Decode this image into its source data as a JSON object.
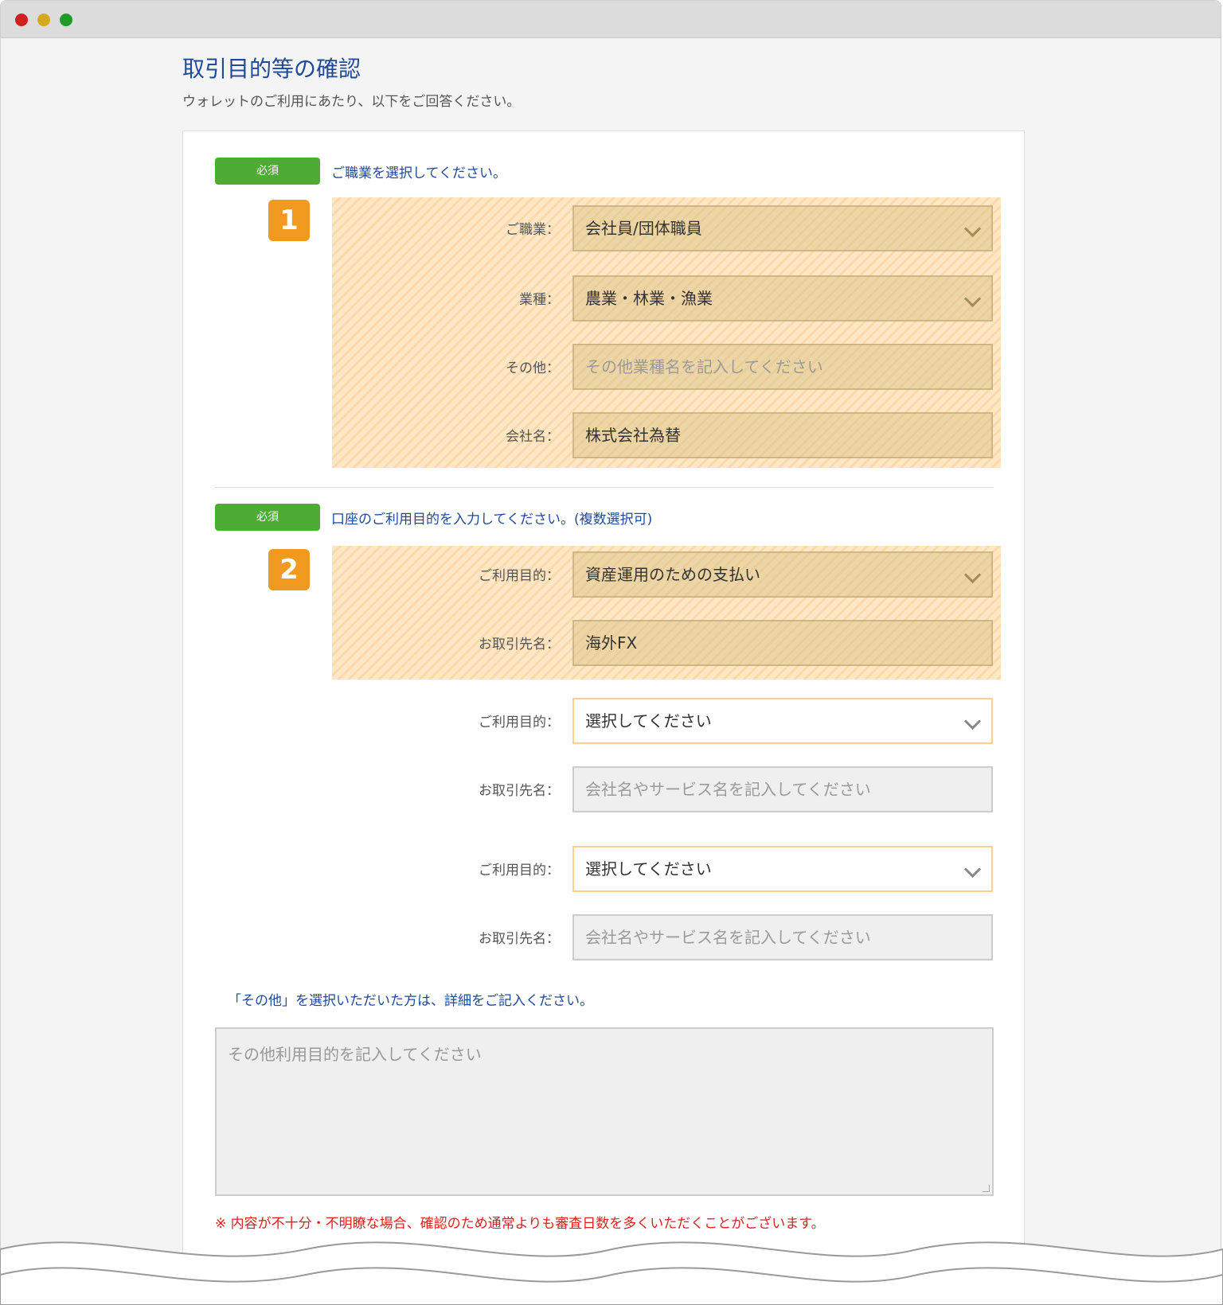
{
  "page": {
    "title": "取引目的等の確認",
    "subtitle": "ウォレットのご利用にあたり、以下をご回答ください。"
  },
  "section1": {
    "badge": "必須",
    "question": "ご職業を選択してください。",
    "step": "1",
    "fields": {
      "occupation": {
        "label": "ご職業：",
        "value": "会社員/団体職員"
      },
      "industry": {
        "label": "業種：",
        "value": "農業・林業・漁業"
      },
      "other": {
        "label": "その他：",
        "placeholder": "その他業種名を記入してください"
      },
      "company": {
        "label": "会社名：",
        "value": "株式会社為替"
      }
    }
  },
  "section2": {
    "badge": "必須",
    "question": "口座のご利用目的を入力してください。(複数選択可)",
    "step": "2",
    "entries": [
      {
        "purpose_label": "ご利用目的：",
        "purpose_value": "資産運用のための支払い",
        "partner_label": "お取引先名：",
        "partner_value": "海外FX"
      },
      {
        "purpose_label": "ご利用目的：",
        "purpose_value": "選択してください",
        "partner_label": "お取引先名：",
        "partner_placeholder": "会社名やサービス名を記入してください"
      },
      {
        "purpose_label": "ご利用目的：",
        "purpose_value": "選択してください",
        "partner_label": "お取引先名：",
        "partner_placeholder": "会社名やサービス名を記入してください"
      }
    ],
    "other_note": "「その他」を選択いただいた方は、詳細をご記入ください。",
    "other_placeholder": "その他利用目的を記入してください",
    "warning": "※ 内容が不十分・不明瞭な場合、確認のため通常よりも審査日数を多くいただくことがございます。"
  },
  "colors": {
    "accent_blue": "#1f4a9a",
    "badge_green": "#4eac34",
    "step_orange": "#f19a1f",
    "warning_red": "#e02020"
  }
}
